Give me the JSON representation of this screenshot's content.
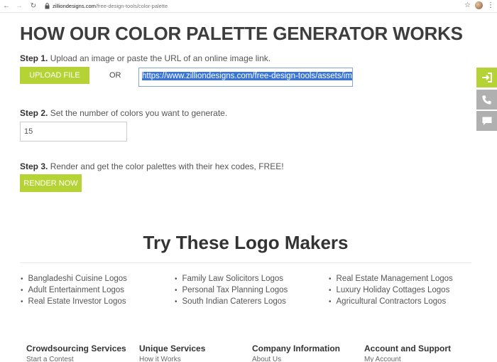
{
  "browser": {
    "url_domain": "zilliondesigns.com",
    "url_path": "/free-design-tools/color-palette"
  },
  "page": {
    "title": "HOW OUR COLOR PALETTE GENERATOR WORKS",
    "step1": {
      "label": "Step 1.",
      "text": "Upload an image or paste the URL of an online image link.",
      "upload_button": "UPLOAD FILE",
      "or_text": "OR",
      "url_value": "https://www.zilliondesigns.com/free-design-tools/assets/im"
    },
    "step2": {
      "label": "Step 2.",
      "text": "Set the number of colors you want to generate.",
      "value": "15"
    },
    "step3": {
      "label": "Step 3.",
      "text": "Render and get the color palettes with their hex codes, FREE!",
      "render_button": "RENDER NOW"
    }
  },
  "logo_makers": {
    "heading": "Try These Logo Makers",
    "columns": [
      [
        "Bangladeshi Cuisine Logos",
        "Adult Entertainment Logos",
        "Real Estate Investor Logos"
      ],
      [
        "Family Law Solicitors Logos",
        "Personal Tax Planning Logos",
        "South Indian Caterers Logos"
      ],
      [
        "Real Estate Management Logos",
        "Luxury Holiday Cottages Logos",
        "Agricultural Contractors Logos"
      ]
    ]
  },
  "footer": {
    "columns": [
      {
        "heading": "Crowdsourcing Services",
        "link": "Start a Contest"
      },
      {
        "heading": "Unique Services",
        "link": "How it Works"
      },
      {
        "heading": "Company Information",
        "link": "About Us"
      },
      {
        "heading": "Account and Support",
        "link": "My Account"
      }
    ]
  },
  "colors": {
    "accent": "#b5d334",
    "side_gray": "#b0b0b0",
    "selection": "#3875d7",
    "heading": "#3d3d3d"
  },
  "icons": {
    "back": "arrow-left-icon",
    "forward": "arrow-right-icon",
    "reload": "reload-icon",
    "lock": "lock-icon",
    "bookmark": "star-icon",
    "menu": "more-vertical-icon",
    "side": [
      "login-icon",
      "phone-icon",
      "chat-icon"
    ]
  }
}
